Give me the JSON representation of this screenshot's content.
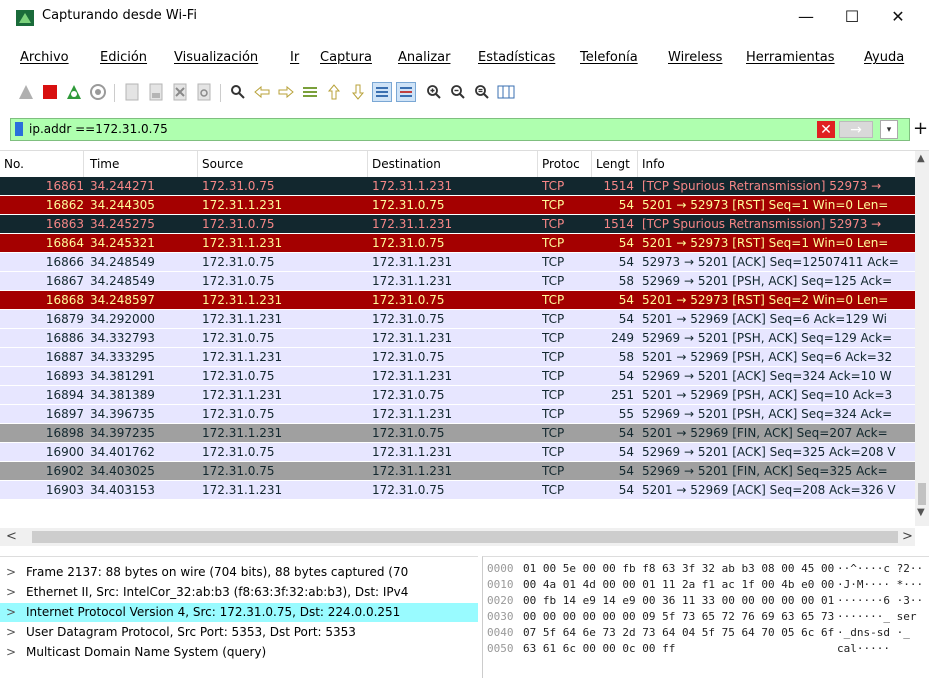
{
  "window": {
    "title": "Capturando desde Wi-Fi",
    "min_glyph": "—",
    "max_glyph": "☐",
    "close_glyph": "✕"
  },
  "menu": [
    "Archivo",
    "Edición",
    "Visualización",
    "Ir",
    "Captura",
    "Analizar",
    "Estadísticas",
    "Telefonía",
    "Wireless",
    "Herramientas",
    "Ayuda"
  ],
  "toolbar_icons": [
    "shark-fin-icon",
    "stop-capture-icon",
    "restart-capture-icon",
    "capture-options-icon",
    "open-file-icon",
    "save-file-icon",
    "close-file-icon",
    "reload-file-icon",
    "find-packet-icon",
    "go-back-icon",
    "go-forward-icon",
    "go-to-packet-icon",
    "go-first-icon",
    "go-last-icon",
    "autoscroll-icon",
    "colorize-icon",
    "zoom-in-icon",
    "zoom-out-icon",
    "zoom-normal-icon",
    "resize-columns-icon"
  ],
  "filter": {
    "value": "ip.addr ==172.31.0.75",
    "clear_glyph": "✕",
    "apply_glyph": "→",
    "dropdown_glyph": "▾",
    "add_glyph": "+"
  },
  "columns": {
    "no": "No.",
    "time": "Time",
    "source": "Source",
    "destination": "Destination",
    "protocol": "Protoc",
    "length": "Lengt",
    "info": "Info"
  },
  "packets": [
    {
      "no": "16861",
      "time": "34.244271",
      "src": "172.31.0.75",
      "dst": "172.31.1.231",
      "proto": "TCP",
      "len": "1514",
      "info": "[TCP Spurious Retransmission] 52973 →",
      "bg": "#12272e",
      "fg": "#f78787"
    },
    {
      "no": "16862",
      "time": "34.244305",
      "src": "172.31.1.231",
      "dst": "172.31.0.75",
      "proto": "TCP",
      "len": "54",
      "info": "5201 → 52973 [RST] Seq=1 Win=0 Len=",
      "bg": "#a40000",
      "fg": "#fffc9c"
    },
    {
      "no": "16863",
      "time": "34.245275",
      "src": "172.31.0.75",
      "dst": "172.31.1.231",
      "proto": "TCP",
      "len": "1514",
      "info": "[TCP Spurious Retransmission] 52973 →",
      "bg": "#12272e",
      "fg": "#f78787"
    },
    {
      "no": "16864",
      "time": "34.245321",
      "src": "172.31.1.231",
      "dst": "172.31.0.75",
      "proto": "TCP",
      "len": "54",
      "info": "5201 → 52973 [RST] Seq=1 Win=0 Len=",
      "bg": "#a40000",
      "fg": "#fffc9c"
    },
    {
      "no": "16866",
      "time": "34.248549",
      "src": "172.31.0.75",
      "dst": "172.31.1.231",
      "proto": "TCP",
      "len": "54",
      "info": "52973 → 5201 [ACK] Seq=12507411 Ack=",
      "bg": "#e7e6ff",
      "fg": "#12272e"
    },
    {
      "no": "16867",
      "time": "34.248549",
      "src": "172.31.0.75",
      "dst": "172.31.1.231",
      "proto": "TCP",
      "len": "58",
      "info": "52969 → 5201 [PSH, ACK] Seq=125 Ack=",
      "bg": "#e7e6ff",
      "fg": "#12272e"
    },
    {
      "no": "16868",
      "time": "34.248597",
      "src": "172.31.1.231",
      "dst": "172.31.0.75",
      "proto": "TCP",
      "len": "54",
      "info": "5201 → 52973 [RST] Seq=2 Win=0 Len=",
      "bg": "#a40000",
      "fg": "#fffc9c"
    },
    {
      "no": "16879",
      "time": "34.292000",
      "src": "172.31.1.231",
      "dst": "172.31.0.75",
      "proto": "TCP",
      "len": "54",
      "info": "5201 → 52969 [ACK] Seq=6 Ack=129 Wi",
      "bg": "#e7e6ff",
      "fg": "#12272e"
    },
    {
      "no": "16886",
      "time": "34.332793",
      "src": "172.31.0.75",
      "dst": "172.31.1.231",
      "proto": "TCP",
      "len": "249",
      "info": "52969 → 5201 [PSH, ACK] Seq=129 Ack=",
      "bg": "#e7e6ff",
      "fg": "#12272e"
    },
    {
      "no": "16887",
      "time": "34.333295",
      "src": "172.31.1.231",
      "dst": "172.31.0.75",
      "proto": "TCP",
      "len": "58",
      "info": "5201 → 52969 [PSH, ACK] Seq=6 Ack=32",
      "bg": "#e7e6ff",
      "fg": "#12272e"
    },
    {
      "no": "16893",
      "time": "34.381291",
      "src": "172.31.0.75",
      "dst": "172.31.1.231",
      "proto": "TCP",
      "len": "54",
      "info": "52969 → 5201 [ACK] Seq=324 Ack=10 W",
      "bg": "#e7e6ff",
      "fg": "#12272e"
    },
    {
      "no": "16894",
      "time": "34.381389",
      "src": "172.31.1.231",
      "dst": "172.31.0.75",
      "proto": "TCP",
      "len": "251",
      "info": "5201 → 52969 [PSH, ACK] Seq=10 Ack=3",
      "bg": "#e7e6ff",
      "fg": "#12272e"
    },
    {
      "no": "16897",
      "time": "34.396735",
      "src": "172.31.0.75",
      "dst": "172.31.1.231",
      "proto": "TCP",
      "len": "55",
      "info": "52969 → 5201 [PSH, ACK] Seq=324 Ack=",
      "bg": "#e7e6ff",
      "fg": "#12272e"
    },
    {
      "no": "16898",
      "time": "34.397235",
      "src": "172.31.1.231",
      "dst": "172.31.0.75",
      "proto": "TCP",
      "len": "54",
      "info": "5201 → 52969 [FIN, ACK] Seq=207 Ack=",
      "bg": "#a0a0a0",
      "fg": "#12272e"
    },
    {
      "no": "16900",
      "time": "34.401762",
      "src": "172.31.0.75",
      "dst": "172.31.1.231",
      "proto": "TCP",
      "len": "54",
      "info": "52969 → 5201 [ACK] Seq=325 Ack=208 V",
      "bg": "#e7e6ff",
      "fg": "#12272e"
    },
    {
      "no": "16902",
      "time": "34.403025",
      "src": "172.31.0.75",
      "dst": "172.31.1.231",
      "proto": "TCP",
      "len": "54",
      "info": "52969 → 5201 [FIN, ACK] Seq=325 Ack=",
      "bg": "#a0a0a0",
      "fg": "#12272e"
    },
    {
      "no": "16903",
      "time": "34.403153",
      "src": "172.31.1.231",
      "dst": "172.31.0.75",
      "proto": "TCP",
      "len": "54",
      "info": "5201 → 52969 [ACK] Seq=208 Ack=326 V",
      "bg": "#e7e6ff",
      "fg": "#12272e"
    }
  ],
  "scroll": {
    "up": "▲",
    "down": "▼",
    "left": "<",
    "right": ">"
  },
  "details": [
    {
      "arrow": ">",
      "text": "Frame 2137: 88 bytes on wire (704 bits), 88 bytes captured (70",
      "selected": false
    },
    {
      "arrow": ">",
      "text": "Ethernet II, Src: IntelCor_32:ab:b3 (f8:63:3f:32:ab:b3), Dst: IPv4",
      "selected": false
    },
    {
      "arrow": ">",
      "text": "Internet Protocol Version 4, Src: 172.31.0.75, Dst: 224.0.0.251",
      "selected": true
    },
    {
      "arrow": ">",
      "text": "User Datagram Protocol, Src Port: 5353, Dst Port: 5353",
      "selected": false
    },
    {
      "arrow": ">",
      "text": "Multicast Domain Name System (query)",
      "selected": false
    }
  ],
  "hex": [
    {
      "offset": "0000",
      "bytes": "01 00 5e 00 00 fb f8 63  3f 32 ab b3 08 00 45 00",
      "ascii": "··^····c ?2··"
    },
    {
      "offset": "0010",
      "bytes": "00 4a 01 4d 00 00 01 11  2a f1 ac 1f 00 4b e0 00",
      "ascii": "·J·M···· *···"
    },
    {
      "offset": "0020",
      "bytes": "00 fb 14 e9 14 e9 00 36  11 33 00 00 00 00 00 01",
      "ascii": "·······6 ·3··"
    },
    {
      "offset": "0030",
      "bytes": "00 00 00 00 00 00 09 5f  73 65 72 76 69 63 65 73",
      "ascii": "·······_ ser"
    },
    {
      "offset": "0040",
      "bytes": "07 5f 64 6e 73 2d 73 64  04 5f 75 64 70 05 6c 6f",
      "ascii": "·_dns-sd ·_"
    },
    {
      "offset": "0050",
      "bytes": "63 61 6c 00 00 0c 00 ff",
      "ascii": "cal·····"
    }
  ],
  "colors": {
    "filter_bg": "#afffaf",
    "selected_detail_bg": "#99fbff",
    "tcp_normal_bg": "#e7e6ff",
    "rst_bg": "#a40000",
    "spurious_bg": "#12272e",
    "fin_bg": "#a0a0a0"
  }
}
